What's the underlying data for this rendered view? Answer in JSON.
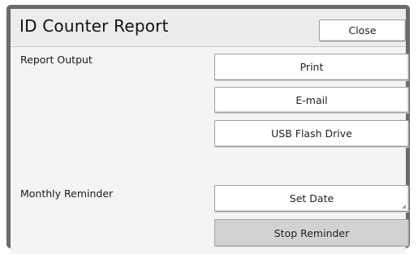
{
  "dialog": {
    "title": "ID Counter Report",
    "close_label": "Close"
  },
  "report_output": {
    "label": "Report Output",
    "buttons": [
      "Print",
      "E-mail",
      "USB Flash Drive"
    ]
  },
  "monthly_reminder": {
    "label": "Monthly Reminder",
    "set_date_label": "Set Date",
    "stop_label": "Stop Reminder"
  },
  "colors": {
    "frame": "#6b6b6b",
    "panel": "#f4f4f4",
    "stop_button_bg": "#d2d2d2"
  }
}
